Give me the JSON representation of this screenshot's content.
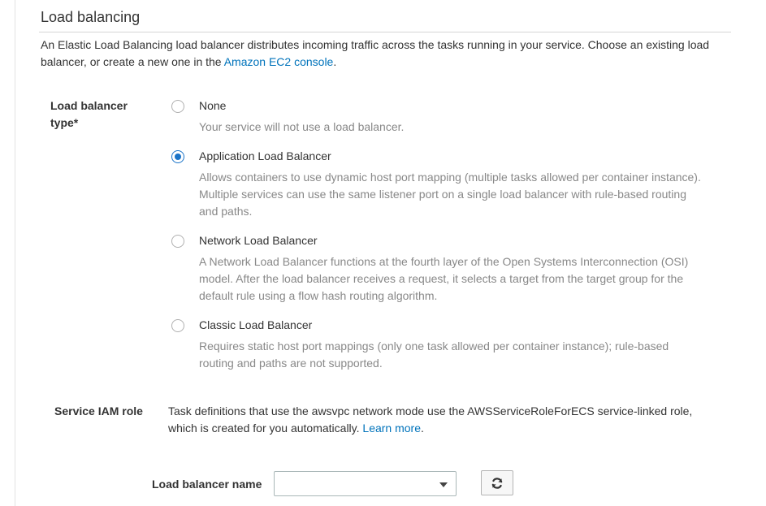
{
  "section": {
    "title": "Load balancing",
    "intro_text": "An Elastic Load Balancing load balancer distributes incoming traffic across the tasks running in your service. Choose an existing load balancer, or create a new one in the ",
    "intro_link": "Amazon EC2 console",
    "intro_end": "."
  },
  "lb_type": {
    "label": "Load balancer type*",
    "options": [
      {
        "label": "None",
        "description": "Your service will not use a load balancer.",
        "selected": false
      },
      {
        "label": "Application Load Balancer",
        "description": "Allows containers to use dynamic host port mapping (multiple tasks allowed per container instance). Multiple services can use the same listener port on a single load balancer with rule-based routing and paths.",
        "selected": true
      },
      {
        "label": "Network Load Balancer",
        "description": "A Network Load Balancer functions at the fourth layer of the Open Systems Interconnection (OSI) model. After the load balancer receives a request, it selects a target from the target group for the default rule using a flow hash routing algorithm.",
        "selected": false
      },
      {
        "label": "Classic Load Balancer",
        "description": "Requires static host port mappings (only one task allowed per container instance); rule-based routing and paths are not supported.",
        "selected": false
      }
    ]
  },
  "iam": {
    "label": "Service IAM role",
    "text": "Task definitions that use the awsvpc network mode use the AWSServiceRoleForECS service-linked role, which is created for you automatically. ",
    "link": "Learn more",
    "end": "."
  },
  "lb_name": {
    "label": "Load balancer name",
    "value": ""
  },
  "colors": {
    "accent": "#1a73c8",
    "link": "#0073bb",
    "muted_text": "#888888"
  },
  "icons": {
    "refresh": "refresh-icon",
    "dropdown": "chevron-down-icon"
  }
}
